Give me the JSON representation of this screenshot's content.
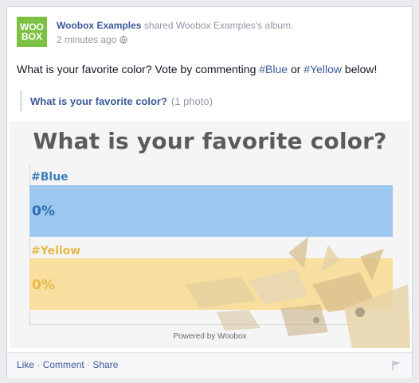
{
  "post": {
    "avatar_text": "WOO BOX",
    "author": "Woobox Examples",
    "shared_text": " shared Woobox Examples's album.",
    "timestamp": "2 minutes ago",
    "status_prefix": "What is your favorite color? Vote by commenting ",
    "hashtag_blue": "#Blue",
    "status_mid": " or ",
    "hashtag_yellow": "#Yellow",
    "status_suffix": " below!",
    "album_title": "What is your favorite color?",
    "album_meta": "(1 photo)"
  },
  "photo": {
    "title": "What is your favorite color?",
    "options": [
      {
        "label": "#Blue",
        "percent_text": "0%",
        "percent": 0,
        "color": "#9ec7f0"
      },
      {
        "label": "#Yellow",
        "percent_text": "0%",
        "percent": 0,
        "color": "#f8dfa0"
      }
    ],
    "powered_by": "Powered by Woobox"
  },
  "actions": {
    "like": "Like",
    "comment": "Comment",
    "share": "Share",
    "separator": " · "
  },
  "icons": {
    "privacy": "globe-icon",
    "report": "flag-icon"
  },
  "colors": {
    "link": "#3b5998",
    "brand_green": "#7dc143",
    "blue_option": "#9ec7f0",
    "yellow_option": "#f8dfa0"
  }
}
